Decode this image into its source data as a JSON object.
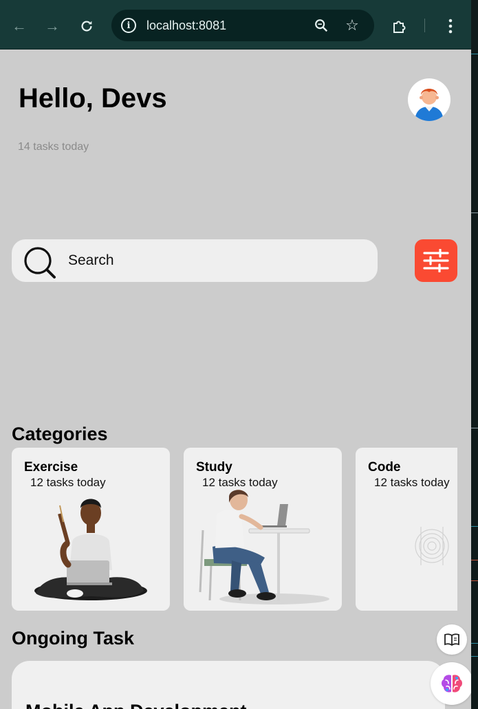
{
  "browser": {
    "url": "localhost:8081",
    "back_icon": "arrow-left-icon",
    "forward_icon": "arrow-right-icon",
    "reload_icon": "reload-icon",
    "site_info_icon": "info-icon",
    "zoom_icon": "zoom-icon",
    "bookmark_icon": "star-icon",
    "extensions_icon": "puzzle-icon",
    "menu_icon": "kebab-menu-icon"
  },
  "header": {
    "greeting": "Hello, Devs",
    "subtitle": "14 tasks today",
    "avatar_icon": "user-avatar-icon"
  },
  "search": {
    "placeholder": "Search",
    "icon": "search-icon",
    "filter_icon": "sliders-icon"
  },
  "categories": {
    "title": "Categories",
    "items": [
      {
        "title": "Exercise",
        "count": "12 tasks today",
        "image": "person-sitting-with-laptop"
      },
      {
        "title": "Study",
        "count": "12 tasks today",
        "image": "person-at-desk-with-laptop"
      },
      {
        "title": "Code",
        "count": "12 tasks today",
        "image": "code-placeholder-icon"
      }
    ]
  },
  "ongoing": {
    "title": "Ongoing Task",
    "task_title": "Mobile App Development"
  },
  "floating": {
    "reader_icon": "reader-mode-icon",
    "assistant_icon": "brain-icon"
  },
  "colors": {
    "page_bg": "#cccccc",
    "card_bg": "#f0f0f0",
    "accent": "#fa4a32",
    "toolbar_bg": "#173a38"
  }
}
